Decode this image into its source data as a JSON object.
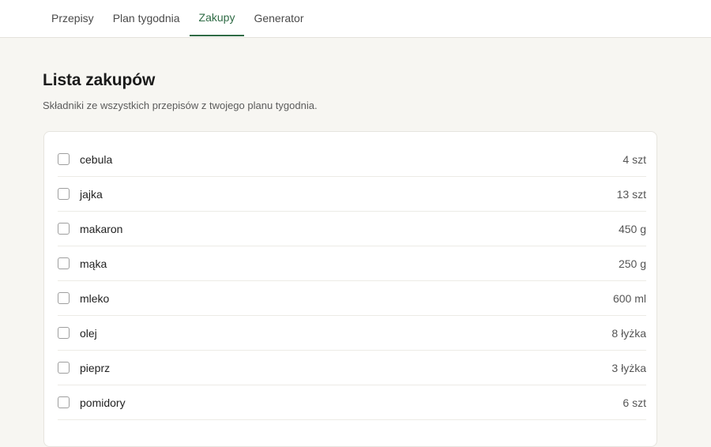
{
  "nav": {
    "tabs": [
      {
        "label": "Przepisy",
        "active": false
      },
      {
        "label": "Plan tygodnia",
        "active": false
      },
      {
        "label": "Zakupy",
        "active": true
      },
      {
        "label": "Generator",
        "active": false
      }
    ]
  },
  "page": {
    "title": "Lista zakupów",
    "subtitle": "Składniki ze wszystkich przepisów z twojego planu tygodnia."
  },
  "shopping_list": {
    "items": [
      {
        "name": "cebula",
        "quantity": "4 szt",
        "checked": false
      },
      {
        "name": "jajka",
        "quantity": "13 szt",
        "checked": false
      },
      {
        "name": "makaron",
        "quantity": "450 g",
        "checked": false
      },
      {
        "name": "mąka",
        "quantity": "250 g",
        "checked": false
      },
      {
        "name": "mleko",
        "quantity": "600 ml",
        "checked": false
      },
      {
        "name": "olej",
        "quantity": "8 łyżka",
        "checked": false
      },
      {
        "name": "pieprz",
        "quantity": "3 łyżka",
        "checked": false
      },
      {
        "name": "pomidory",
        "quantity": "6 szt",
        "checked": false
      }
    ]
  },
  "colors": {
    "accent": "#2f6b45",
    "background": "#f7f6f2",
    "card": "#ffffff"
  }
}
